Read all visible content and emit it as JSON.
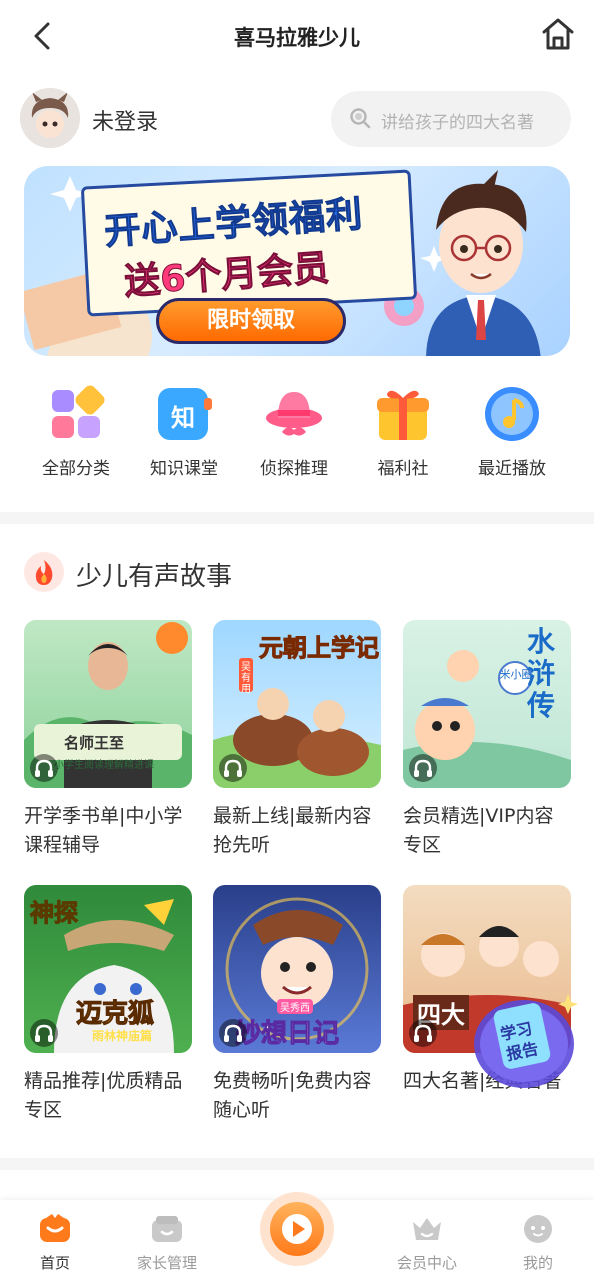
{
  "header": {
    "title": "喜马拉雅少儿"
  },
  "user": {
    "name": "未登录"
  },
  "search": {
    "placeholder": "讲给孩子的四大名著"
  },
  "banner": {
    "line1": "开心上学领福利",
    "line2": "送6个月会员",
    "button": "限时领取"
  },
  "quick_entries": [
    {
      "label": "全部分类",
      "icon": "grid-icon"
    },
    {
      "label": "知识课堂",
      "icon": "knowledge-icon"
    },
    {
      "label": "侦探推理",
      "icon": "detective-hat-icon"
    },
    {
      "label": "福利社",
      "icon": "gift-icon"
    },
    {
      "label": "最近播放",
      "icon": "music-note-icon"
    }
  ],
  "knowledge_icon_glyph": "知",
  "section": {
    "title": "少儿有声故事"
  },
  "cards": [
    {
      "title": "开学季书单|中小学课程辅导",
      "cover_text": "名师王至",
      "cover_sub": "小学生阅读理解精进课"
    },
    {
      "title": "最新上线|最新内容抢先听",
      "cover_text": "元朝上学记",
      "cover_sub": "吴有用"
    },
    {
      "title": "会员精选|VIP内容专区",
      "cover_text": "水浒传",
      "cover_sub": "米小圈"
    },
    {
      "title": "精品推荐|优质精品专区",
      "cover_text": "迈克狐",
      "cover_sub": "雨林神庙篇",
      "cover_top": "神探"
    },
    {
      "title": "免费畅听|免费内容随心听",
      "cover_text": "妙想日记",
      "cover_sub": "吴秀西"
    },
    {
      "title": "四大名著|经典名著",
      "cover_text": "四大"
    }
  ],
  "float_badge": {
    "line1": "学习",
    "line2": "报告"
  },
  "tabbar": [
    {
      "label": "首页",
      "active": true
    },
    {
      "label": "家长管理",
      "active": false
    },
    {
      "label": "",
      "center": true
    },
    {
      "label": "会员中心",
      "active": false
    },
    {
      "label": "我的",
      "active": false
    }
  ],
  "colors": {
    "accent": "#ff7a1a",
    "text": "#333333",
    "muted": "#9a9a9a"
  }
}
